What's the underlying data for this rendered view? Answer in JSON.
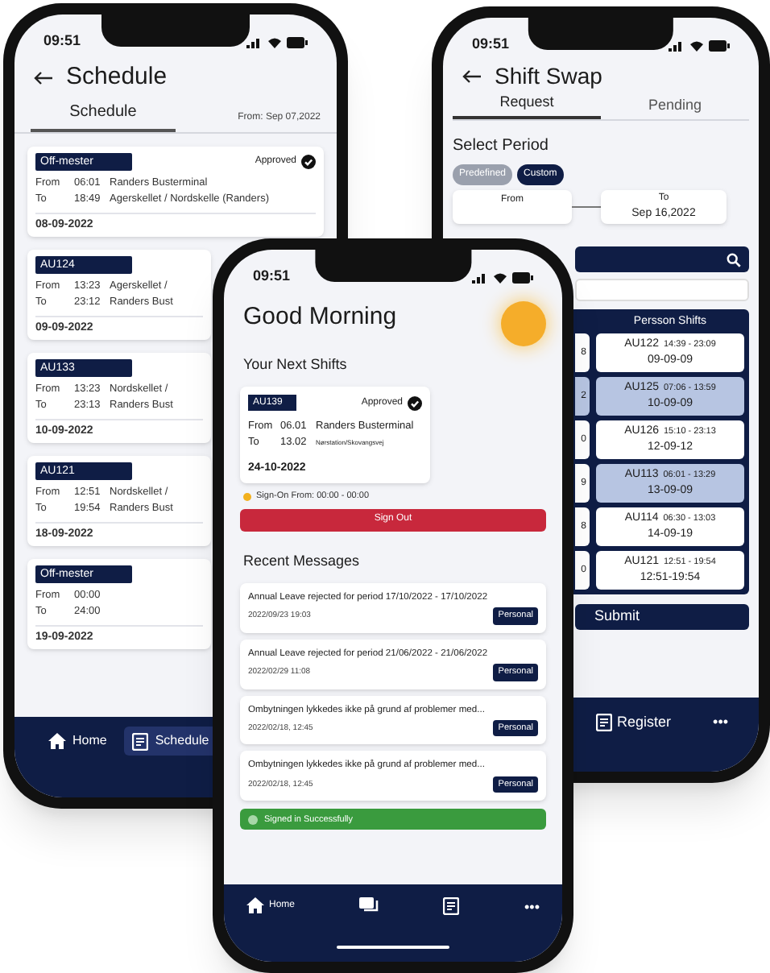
{
  "schedule_screen": {
    "time": "09:51",
    "title": "Schedule",
    "tabs": [
      {
        "label": "Schedule",
        "selected": true
      }
    ],
    "range": "From: Sep 07,2022",
    "shifts": [
      {
        "code": "Off-mester",
        "status": "Approved",
        "from_label": "From",
        "from_time": "06:01",
        "from_place": "Randers Busterminal",
        "to_label": "To",
        "to_time": "18:49",
        "to_place": "Agerskellet / Nordskelle (Randers)",
        "date": "08-09-2022"
      },
      {
        "code": "AU124",
        "from_label": "From",
        "from_time": "13:23",
        "from_place": "Agerskellet / ",
        "to_label": "To",
        "to_time": "23:12",
        "to_place": "Randers Bust",
        "date": "09-09-2022"
      },
      {
        "code": "AU133",
        "from_label": "From",
        "from_time": "13:23",
        "from_place": "Nordskellet / ",
        "to_label": "To",
        "to_time": "23:13",
        "to_place": "Randers Bust",
        "date": "10-09-2022"
      },
      {
        "code": "AU121",
        "from_label": "From",
        "from_time": "12:51",
        "from_place": "Nordskellet / ",
        "to_label": "To",
        "to_time": "19:54",
        "to_place": "Randers Bust",
        "date": "18-09-2022"
      },
      {
        "code": "Off-mester",
        "from_label": "From",
        "from_time": "00:00",
        "to_label": "To",
        "to_time": "24:00",
        "date": "19-09-2022"
      }
    ],
    "nav": [
      {
        "kind": "home",
        "label": "Home",
        "selected": false
      },
      {
        "kind": "schedule",
        "label": "Schedule",
        "selected": true
      }
    ]
  },
  "shift_swap_screen": {
    "time": "09:51",
    "title": "Shift Swap",
    "tabs": [
      {
        "label": "Request",
        "selected": true
      },
      {
        "label": "Pending",
        "selected": false
      }
    ],
    "section": "Select Period",
    "chips": [
      {
        "label": "Predefined",
        "selected": false
      },
      {
        "label": "Custom",
        "selected": true
      }
    ],
    "from_label": "From",
    "to_label": "To",
    "to_value": "Sep 16,2022",
    "left_column": [
      {
        "text": "8",
        "selected": false
      },
      {
        "text": "2",
        "selected": true
      },
      {
        "text": "0",
        "selected": false
      },
      {
        "text": "9",
        "selected": false
      },
      {
        "text": "8",
        "selected": false
      },
      {
        "text": "0",
        "selected": false
      }
    ],
    "column_title": "Persson Shifts",
    "shifts": [
      {
        "code": "AU122",
        "time": "14:39 - 23:09",
        "date": "09-09-09",
        "selected": false
      },
      {
        "code": "AU125",
        "time": "07:06 - 13:59",
        "date": "10-09-09",
        "selected": true
      },
      {
        "code": "AU126",
        "time": "15:10 - 23:13",
        "date": "12-09-12",
        "selected": false
      },
      {
        "code": "AU113",
        "time": "06:01 - 13:29",
        "date": "13-09-09",
        "selected": true
      },
      {
        "code": "AU114",
        "time": "06:30 - 13:03",
        "date": "14-09-19",
        "selected": false
      },
      {
        "code": "AU121",
        "time": "12:51 - 19:54",
        "date": "12:51-19:54",
        "selected": false
      }
    ],
    "submit": "Submit",
    "nav": [
      {
        "kind": "register",
        "label": "Register"
      },
      {
        "kind": "more",
        "label": "•••"
      }
    ]
  },
  "home_screen": {
    "time": "09:51",
    "greeting": "Good Morning",
    "next_title": "Your Next Shifts",
    "shift": {
      "code": "AU139",
      "status": "Approved",
      "from_label": "From",
      "from_time": "06.01",
      "from_place": "Randers Busterminal",
      "to_label": "To",
      "to_time": "13.02",
      "to_place": "Nørstation/Skovangsvej",
      "date": "24-10-2022"
    },
    "sign_on": "Sign-On From: 00:00 - 00:00",
    "sign_out": "Sign Out",
    "messages_title": "Recent Messages",
    "messages": [
      {
        "text": "Annual Leave rejected for period 17/10/2022 - 17/10/2022",
        "time": "2022/09/23 19:03",
        "tag": "Personal"
      },
      {
        "text": "Annual Leave rejected for period 21/06/2022 - 21/06/2022",
        "time": "2022/02/29 11:08",
        "tag": "Personal"
      },
      {
        "text": "Ombytningen lykkedes ikke på grund af problemer med...",
        "time": "2022/02/18, 12:45",
        "tag": "Personal"
      },
      {
        "text": "Ombytningen lykkedes ikke på grund af problemer med...",
        "time": "2022/02/18, 12:45",
        "tag": "Personal"
      }
    ],
    "toast": "Signed in Successfully",
    "nav": [
      {
        "kind": "home",
        "label": "Home"
      },
      {
        "kind": "chat"
      },
      {
        "kind": "document"
      },
      {
        "kind": "more",
        "label": "•••"
      }
    ]
  }
}
